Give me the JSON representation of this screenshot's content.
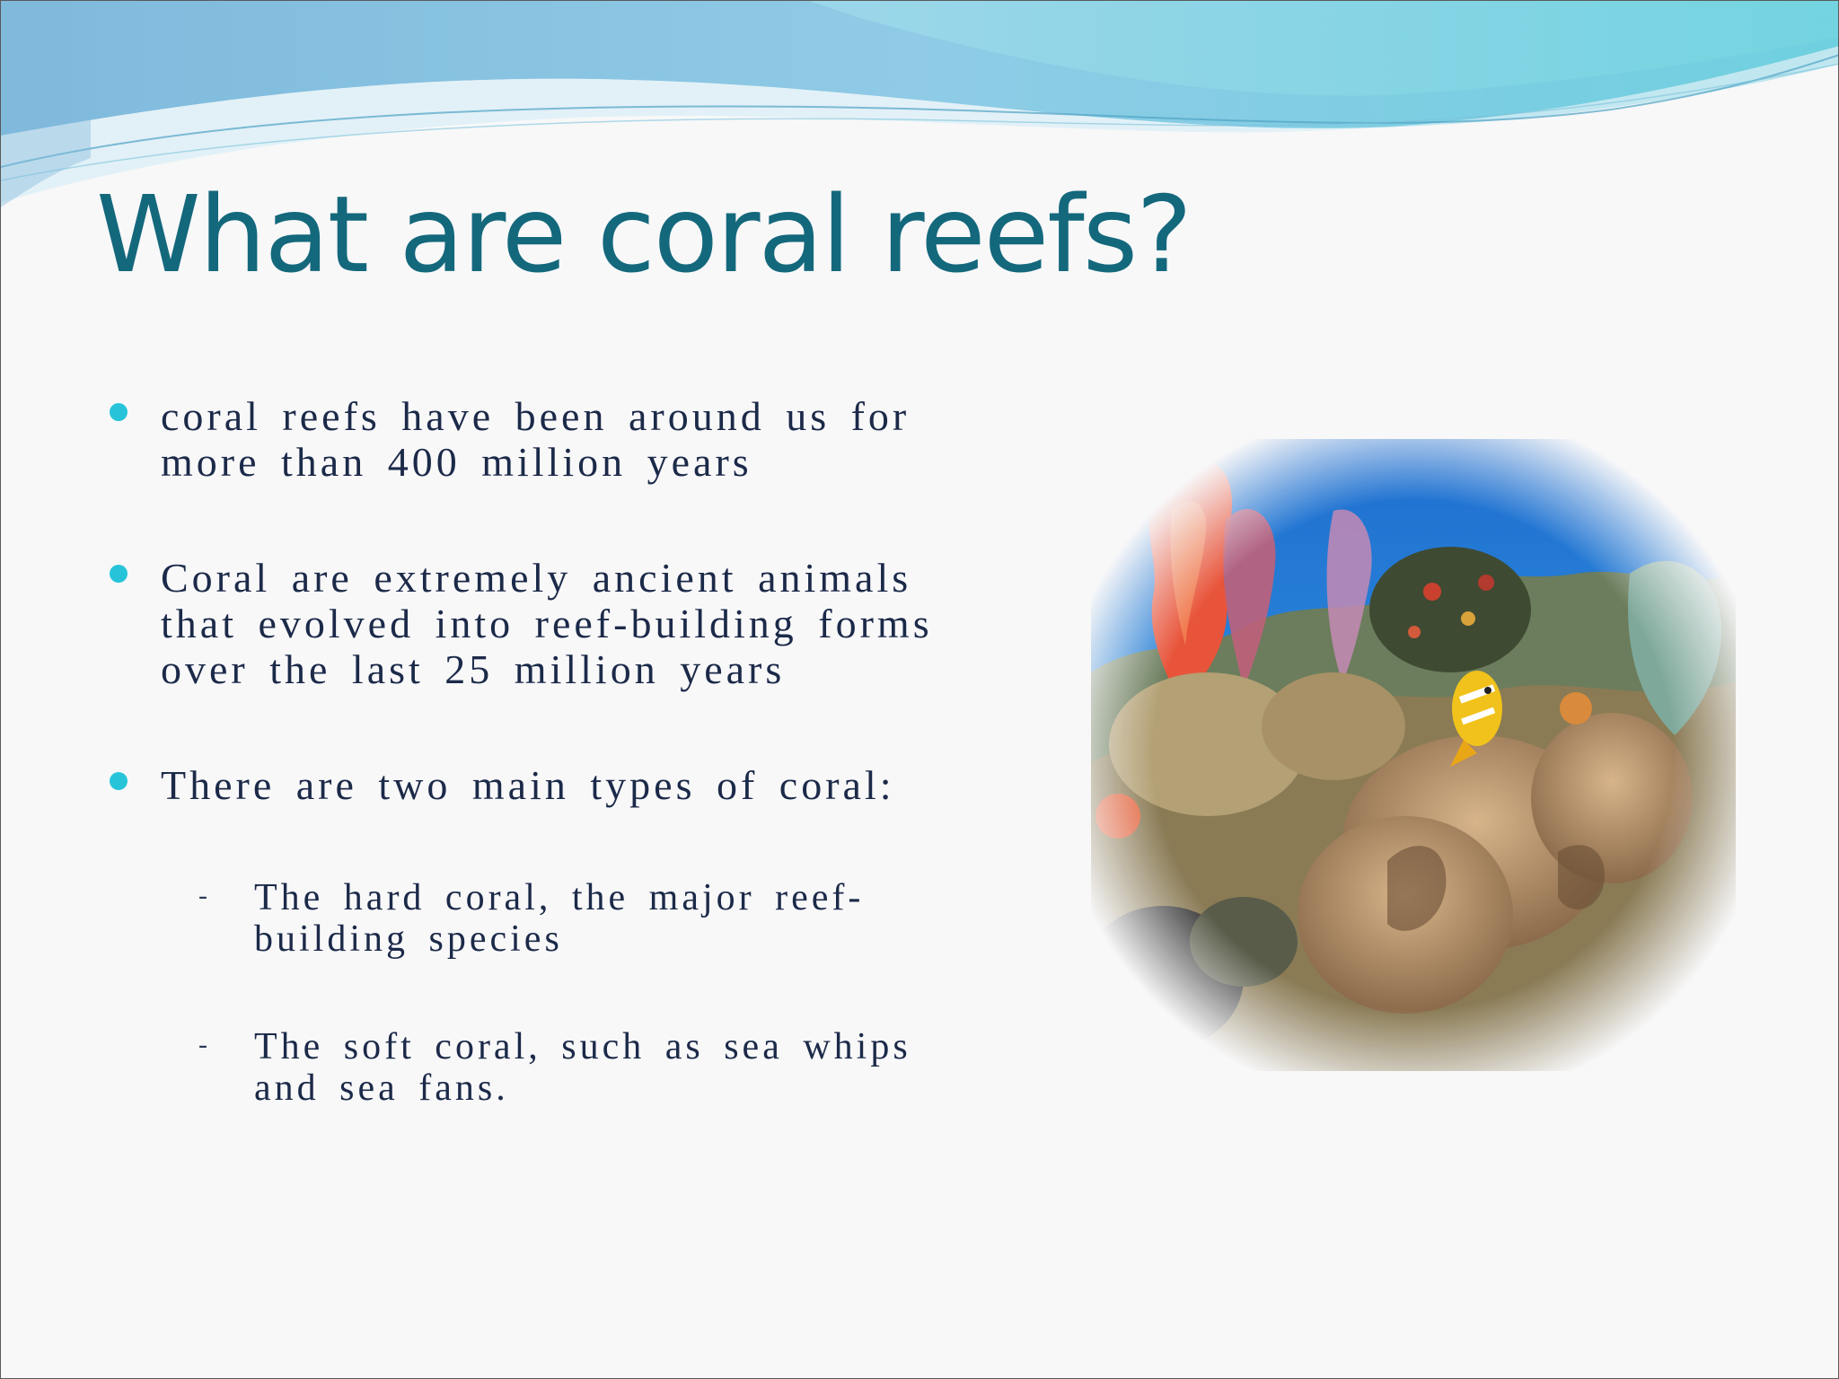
{
  "slide": {
    "title": "What are coral reefs?",
    "bullets": [
      {
        "lines": [
          "coral reefs have been around us for",
          "more than 400 million years"
        ]
      },
      {
        "lines": [
          "Coral are extremely ancient animals",
          "that evolved into reef-building forms",
          "over the last 25 million years"
        ]
      },
      {
        "lines": [
          "There are two main types of coral:"
        ]
      }
    ],
    "sub_items": [
      {
        "marker": "-",
        "lines": [
          "The hard coral, the major reef-",
          "building species"
        ]
      },
      {
        "marker": "-",
        "lines": [
          "The soft coral, such as sea whips",
          "and sea fans."
        ]
      }
    ],
    "image": {
      "subject": "coral reef underwater photo with clownfish"
    }
  },
  "colors": {
    "title": "#14687c",
    "body_text": "#1c2a49",
    "bullet": "#27c4d9",
    "wave_light": "#8fd3e8",
    "wave_dark": "#5fb2d6"
  }
}
